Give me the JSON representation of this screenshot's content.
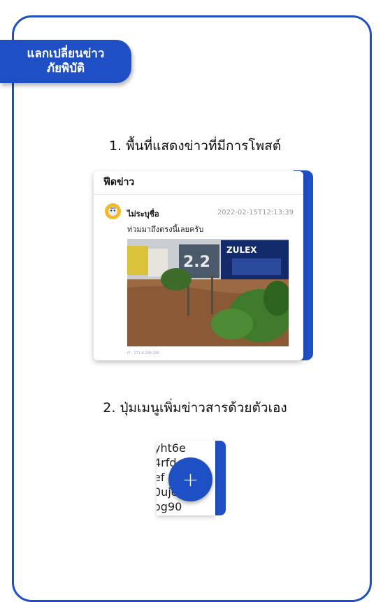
{
  "ribbon": {
    "line1": "แลกเปลี่ยนข่าว",
    "line2": "ภัยพิบัติ"
  },
  "section1": {
    "title": "1. พื้นที่แสดงข่าวที่มีการโพสต์"
  },
  "feed": {
    "header": "ฟีดข่าว",
    "post": {
      "author": "ไม่ระบุชื่อ",
      "timestamp": "2022-02-15T12:13:39",
      "message": "ท่วมมาถึงตรงนี้เลยครับ",
      "ip": "IP : 171.6.248.156",
      "billboard_text": "ZULEX"
    }
  },
  "section2": {
    "title": "2. ปุ่มเมนูเพิ่มข่าวสารด้วยตัวเอง"
  },
  "fab_preview": {
    "lines": [
      "yht6e",
      "4rfd",
      "ef",
      "0ujon",
      "og90"
    ],
    "button_symbol": "+"
  },
  "colors": {
    "accent": "#1f4fc4"
  }
}
